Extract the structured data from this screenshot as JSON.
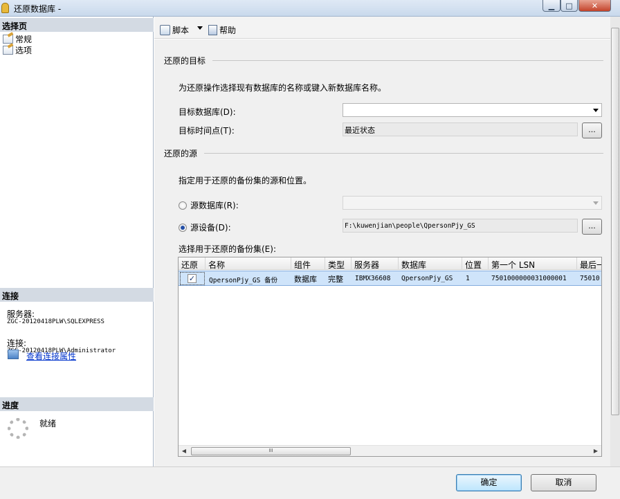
{
  "window": {
    "title": "还原数据库 -",
    "controls": {
      "minimize": "▁",
      "maximize": "□",
      "close": "✕"
    }
  },
  "left_pane": {
    "select_page_header": "选择页",
    "pages": [
      "常规",
      "选项"
    ],
    "connection_header": "连接",
    "server_label": "服务器:",
    "server_value": "ZGC-20120418PLW\\SQLEXPRESS",
    "connection_label": "连接:",
    "connection_value": "ZGC-20120418PLW\\Administrator",
    "view_connection_link": "查看连接属性",
    "progress_header": "进度",
    "progress_status": "就绪"
  },
  "toolbar": {
    "script_label": "脚本",
    "help_label": "帮助"
  },
  "restore_target": {
    "section_title": "还原的目标",
    "description": "为还原操作选择现有数据库的名称或键入新数据库名称。",
    "target_db_label": "目标数据库(D):",
    "target_db_value": "",
    "target_time_label": "目标时间点(T):",
    "target_time_value": "最近状态",
    "browse_label": "..."
  },
  "restore_source": {
    "section_title": "还原的源",
    "description": "指定用于还原的备份集的源和位置。",
    "source_db_label": "源数据库(R):",
    "source_device_label": "源设备(D):",
    "source_device_value": "F:\\kuwenjian\\people\\QpersonPjy_GS",
    "browse_label": "...",
    "selected_option": "source_device"
  },
  "backup_sets": {
    "label": "选择用于还原的备份集(E):",
    "columns": [
      "还原",
      "名称",
      "组件",
      "类型",
      "服务器",
      "数据库",
      "位置",
      "第一个 LSN",
      "最后一"
    ],
    "rows": [
      {
        "restore": true,
        "name": "QpersonPjy_GS 备份",
        "component": "数据库",
        "type": "完整",
        "server": "IBMX36608",
        "database": "QpersonPjy_GS",
        "position": "1",
        "first_lsn": "7501000000031000001",
        "last_lsn": "75010"
      }
    ],
    "scroll_left": "◀",
    "scroll_right": "▶",
    "scroll_grip": "III"
  },
  "buttons": {
    "ok": "确定",
    "cancel": "取消"
  },
  "colors": {
    "selection": "#cfe4fa",
    "link": "#0033cc",
    "header_band": "#d3dae3"
  }
}
